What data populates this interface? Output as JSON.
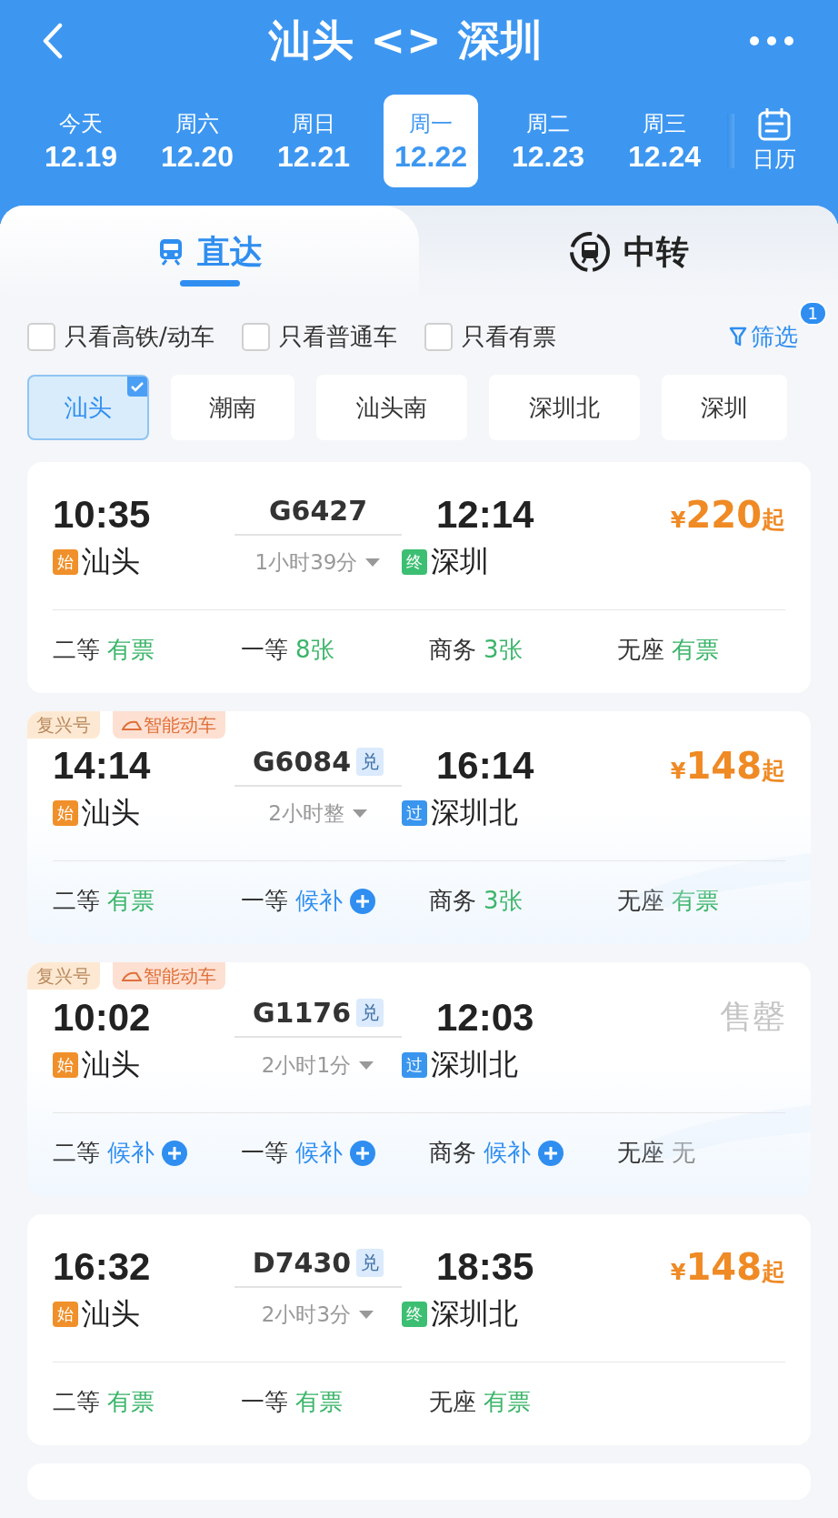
{
  "header": {
    "title": "汕头 <> 深圳"
  },
  "dates": [
    {
      "weekday": "今天",
      "date": "12.19",
      "selected": false
    },
    {
      "weekday": "周六",
      "date": "12.20",
      "selected": false
    },
    {
      "weekday": "周日",
      "date": "12.21",
      "selected": false
    },
    {
      "weekday": "周一",
      "date": "12.22",
      "selected": true
    },
    {
      "weekday": "周二",
      "date": "12.23",
      "selected": false
    },
    {
      "weekday": "周三",
      "date": "12.24",
      "selected": false
    }
  ],
  "calendar": {
    "label": "日历"
  },
  "tabs": [
    {
      "label": "直达",
      "kind": "direct",
      "selected": true
    },
    {
      "label": "中转",
      "kind": "transfer",
      "selected": false
    }
  ],
  "filters": [
    {
      "label": "只看高铁/动车",
      "checked": false
    },
    {
      "label": "只看普通车",
      "checked": false
    },
    {
      "label": "只看有票",
      "checked": false
    }
  ],
  "filter_button": {
    "label": "筛选",
    "badge": "1"
  },
  "stations": [
    {
      "label": "汕头",
      "selected": true
    },
    {
      "label": "潮南",
      "selected": false
    },
    {
      "label": "汕头南",
      "selected": false
    },
    {
      "label": "深圳北",
      "selected": false
    },
    {
      "label": "深圳",
      "selected": false
    }
  ],
  "trains": [
    {
      "depart": "10:35",
      "train_no": "G6427",
      "duration": "1小时39分",
      "arrive": "12:14",
      "from_mark": {
        "label": "始",
        "kind": "start"
      },
      "from_station": "汕头",
      "to_mark": {
        "label": "终",
        "kind": "end"
      },
      "to_station": "深圳",
      "price": {
        "symbol": "¥",
        "amount": "220",
        "suffix": "起"
      },
      "seats": [
        {
          "class": "二等",
          "availability": "有票",
          "kind": "available"
        },
        {
          "class": "一等",
          "availability": "8张",
          "kind": "available"
        },
        {
          "class": "商务",
          "availability": "3张",
          "kind": "available"
        },
        {
          "class": "无座",
          "availability": "有票",
          "kind": "available"
        }
      ]
    },
    {
      "tags": [
        {
          "label": "复兴号",
          "kind": "plain"
        },
        {
          "label": "智能动车",
          "kind": "smart"
        }
      ],
      "depart": "14:14",
      "train_no": "G6084",
      "exchange": "兑",
      "duration": "2小时整",
      "arrive": "16:14",
      "from_mark": {
        "label": "始",
        "kind": "start"
      },
      "from_station": "汕头",
      "to_mark": {
        "label": "过",
        "kind": "pass"
      },
      "to_station": "深圳北",
      "price": {
        "symbol": "¥",
        "amount": "148",
        "suffix": "起"
      },
      "seats": [
        {
          "class": "二等",
          "availability": "有票",
          "kind": "available"
        },
        {
          "class": "一等",
          "availability": "候补",
          "kind": "waitlist"
        },
        {
          "class": "商务",
          "availability": "3张",
          "kind": "available"
        },
        {
          "class": "无座",
          "availability": "有票",
          "kind": "available"
        }
      ]
    },
    {
      "tags": [
        {
          "label": "复兴号",
          "kind": "plain"
        },
        {
          "label": "智能动车",
          "kind": "smart"
        }
      ],
      "depart": "10:02",
      "train_no": "G1176",
      "exchange": "兑",
      "duration": "2小时1分",
      "arrive": "12:03",
      "from_mark": {
        "label": "始",
        "kind": "start"
      },
      "from_station": "汕头",
      "to_mark": {
        "label": "过",
        "kind": "pass"
      },
      "to_station": "深圳北",
      "status": "售罄",
      "seats": [
        {
          "class": "二等",
          "availability": "候补",
          "kind": "waitlist"
        },
        {
          "class": "一等",
          "availability": "候补",
          "kind": "waitlist"
        },
        {
          "class": "商务",
          "availability": "候补",
          "kind": "waitlist"
        },
        {
          "class": "无座",
          "availability": "无",
          "kind": "none"
        }
      ]
    },
    {
      "depart": "16:32",
      "train_no": "D7430",
      "exchange": "兑",
      "duration": "2小时3分",
      "arrive": "18:35",
      "from_mark": {
        "label": "始",
        "kind": "start"
      },
      "from_station": "汕头",
      "to_mark": {
        "label": "终",
        "kind": "end"
      },
      "to_station": "深圳北",
      "price": {
        "symbol": "¥",
        "amount": "148",
        "suffix": "起"
      },
      "seats": [
        {
          "class": "二等",
          "availability": "有票",
          "kind": "available"
        },
        {
          "class": "一等",
          "availability": "有票",
          "kind": "available"
        },
        {
          "class": "无座",
          "availability": "有票",
          "kind": "available"
        }
      ]
    }
  ]
}
